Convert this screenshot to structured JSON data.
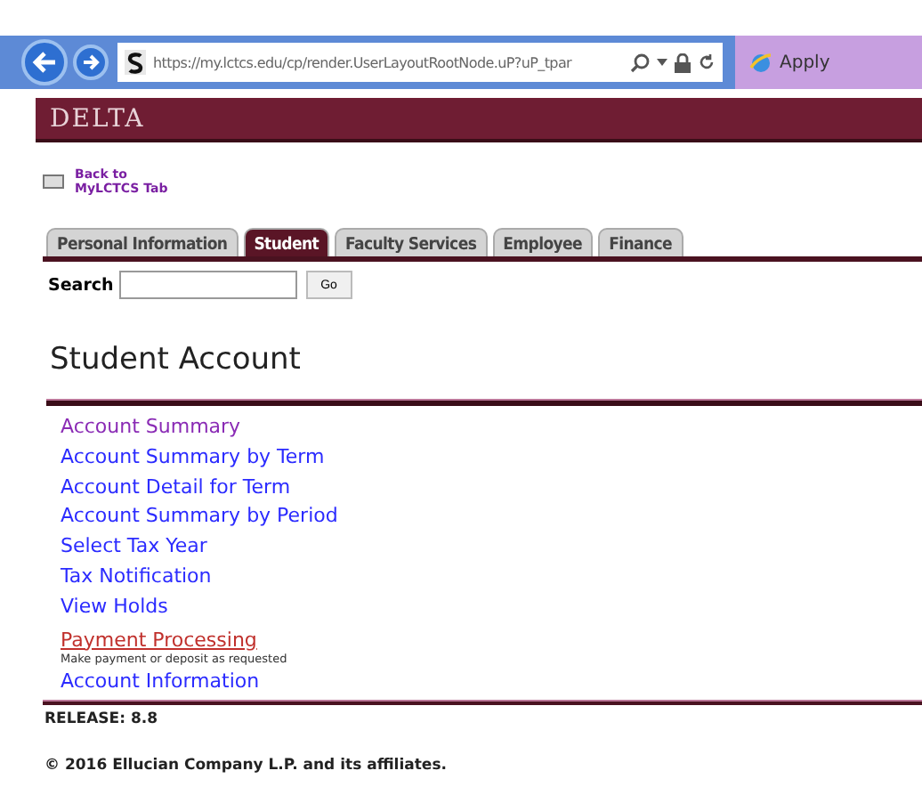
{
  "browser": {
    "address": "https://my.lctcs.edu/cp/render.UserLayoutRootNode.uP?uP_tpar",
    "tab_title": "Apply"
  },
  "banner": {
    "logo": "DELTA"
  },
  "back_link": {
    "line1": "Back to",
    "line2": "MyLCTCS Tab"
  },
  "tabs": [
    {
      "label": "Personal Information",
      "selected": false
    },
    {
      "label": "Student",
      "selected": true
    },
    {
      "label": "Faculty Services",
      "selected": false
    },
    {
      "label": "Employee",
      "selected": false
    },
    {
      "label": "Finance",
      "selected": false
    }
  ],
  "search": {
    "label": "Search",
    "button": "Go"
  },
  "heading": "Student Account",
  "links": [
    {
      "label": "Account Summary",
      "kind": "visited"
    },
    {
      "label": "Account Summary by Term",
      "kind": "link"
    },
    {
      "label": "Account Detail for Term",
      "kind": "link"
    },
    {
      "label": "Account Summary by Period",
      "kind": "link"
    },
    {
      "label": "Select Tax Year",
      "kind": "link"
    },
    {
      "label": "Tax Notification",
      "kind": "link"
    },
    {
      "label": "View Holds",
      "kind": "link"
    },
    {
      "label": "Payment Processing",
      "kind": "hover",
      "description": "Make payment or deposit as requested"
    },
    {
      "label": "Account Information",
      "kind": "link"
    }
  ],
  "release": "RELEASE: 8.8",
  "copyright": "© 2016 Ellucian Company L.P. and its affiliates."
}
